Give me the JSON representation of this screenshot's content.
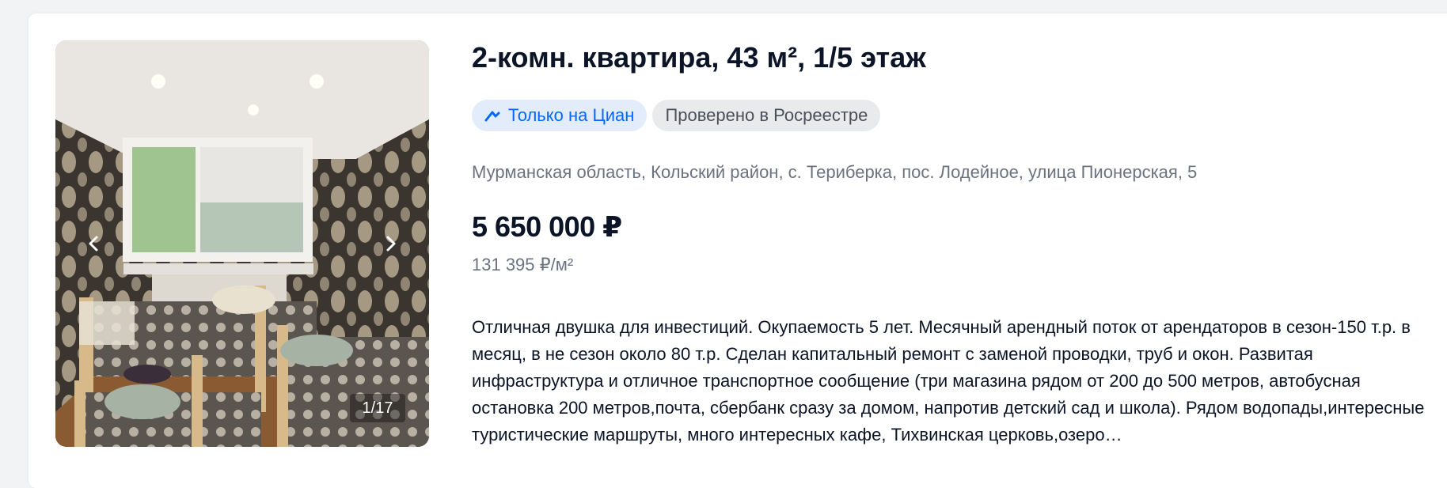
{
  "listing": {
    "title": "2-комн. квартира, 43 м², 1/5 этаж",
    "badges": [
      {
        "label": "Только на Циан",
        "icon": "cian-logo-icon",
        "color": "#0468ff"
      },
      {
        "label": "Проверено в Росреестре"
      }
    ],
    "address": "Мурманская область, Кольский район, с. Териберка, пос. Лодейное, улица Пионерская, 5",
    "price": "5 650 000 ₽",
    "price_per_sqm": "131 395 ₽/м²",
    "description": "Отличная двушка для инвестиций. Окупаемость 5 лет. Месячный арендный поток от арендаторов в сезон-150 т.р. в месяц, в не сезон около 80 т.р. Сделан капитальный ремонт с заменой проводки, труб и окон. Развитая инфраструктура и отличное транспортное сообщение (три магазина рядом от 200 до 500 метров, автобусная остановка 200 метров,почта, сбербанк сразу за домом, напротив детский сад и школа). Рядом водопады,интересные туристические маршруты, много интересных кафе, Тихвинская церковь,озеро…"
  },
  "gallery": {
    "counter": "1/17",
    "prev_icon": "chevron-left-icon",
    "next_icon": "chevron-right-icon"
  }
}
